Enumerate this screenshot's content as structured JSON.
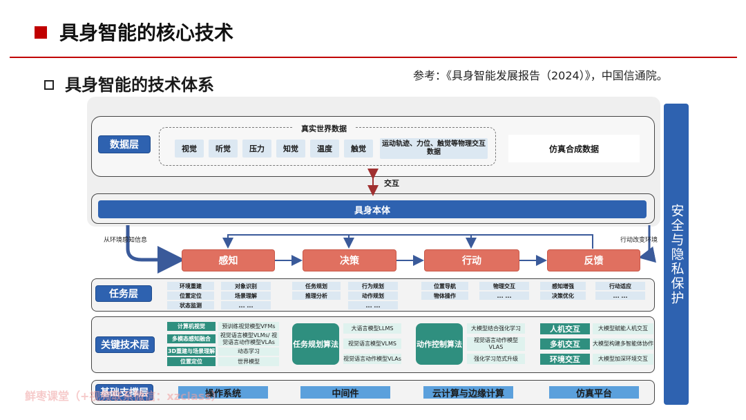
{
  "header": {
    "title": "具身智能的核心技术",
    "subtitle": "具身智能的技术体系",
    "reference": "参考：《具身智能发展报告（2024）》，中国信通院。"
  },
  "data_layer": {
    "label": "数据层",
    "real_title": "真实世界数据",
    "chips": [
      "视觉",
      "听觉",
      "压力",
      "知觉",
      "温度",
      "触觉"
    ],
    "wide_chip": "运动轨迹、力位、触觉等物理交互数据",
    "sim": "仿真合成数据"
  },
  "interaction": "交互",
  "body_label": "具身本体",
  "env_left": "从环境感知信息",
  "env_right": "行动改变环境",
  "stages": [
    "感知",
    "决策",
    "行动",
    "反馈"
  ],
  "task_layer": {
    "label": "任务层",
    "items": [
      "环境重建",
      "对象识别",
      "位置定位",
      "场景理解",
      "状态监测",
      "... ...",
      "任务规划",
      "行为规划",
      "推理分析",
      "动作规划",
      "... ...",
      "位置导航",
      "物理交互",
      "物体操作",
      "... ...",
      "感知增强",
      "行动适应",
      "决策优化",
      "... ..."
    ]
  },
  "key_layer": {
    "label": "关键技术层",
    "perception_labels": [
      "计算机视觉",
      "多模态感知融合",
      "3D重建与场景理解",
      "位置定位"
    ],
    "perception_models": [
      "预训练视觉模型VFMs",
      "视觉语言模型VLMs/ 视觉语言动作模型VLAs",
      "动态学习",
      "世界模型"
    ],
    "task_algo": "任务规划算法",
    "task_models": [
      "大语言模型LLMS",
      "视觉语言模型VLMS",
      "视觉语言动作模型VLAs"
    ],
    "action_algo": "动作控制算法",
    "action_models": [
      "大模型结合强化学习",
      "视觉语言动作模型 VLAS",
      "强化学习范式升级"
    ],
    "interaction_labels": [
      "人机交互",
      "多机交互",
      "环境交互"
    ],
    "interaction_models": [
      "大模型赋能人机交互",
      "大模型构建多智能体协作",
      "大模型加深环境交互"
    ]
  },
  "base_layer": {
    "label": "基础支撑层",
    "items": [
      "操作系统",
      "中间件",
      "云计算与边缘计算",
      "仿真平台"
    ]
  },
  "side_bar": "安全与隐私保护",
  "watermark": "鲜枣课堂（+视频联系微信：xzclass）",
  "colors": {
    "accent": "#c00000",
    "primary_blue": "#2e62b0",
    "stage_red": "#e07060",
    "teal": "#2f8f7f"
  }
}
